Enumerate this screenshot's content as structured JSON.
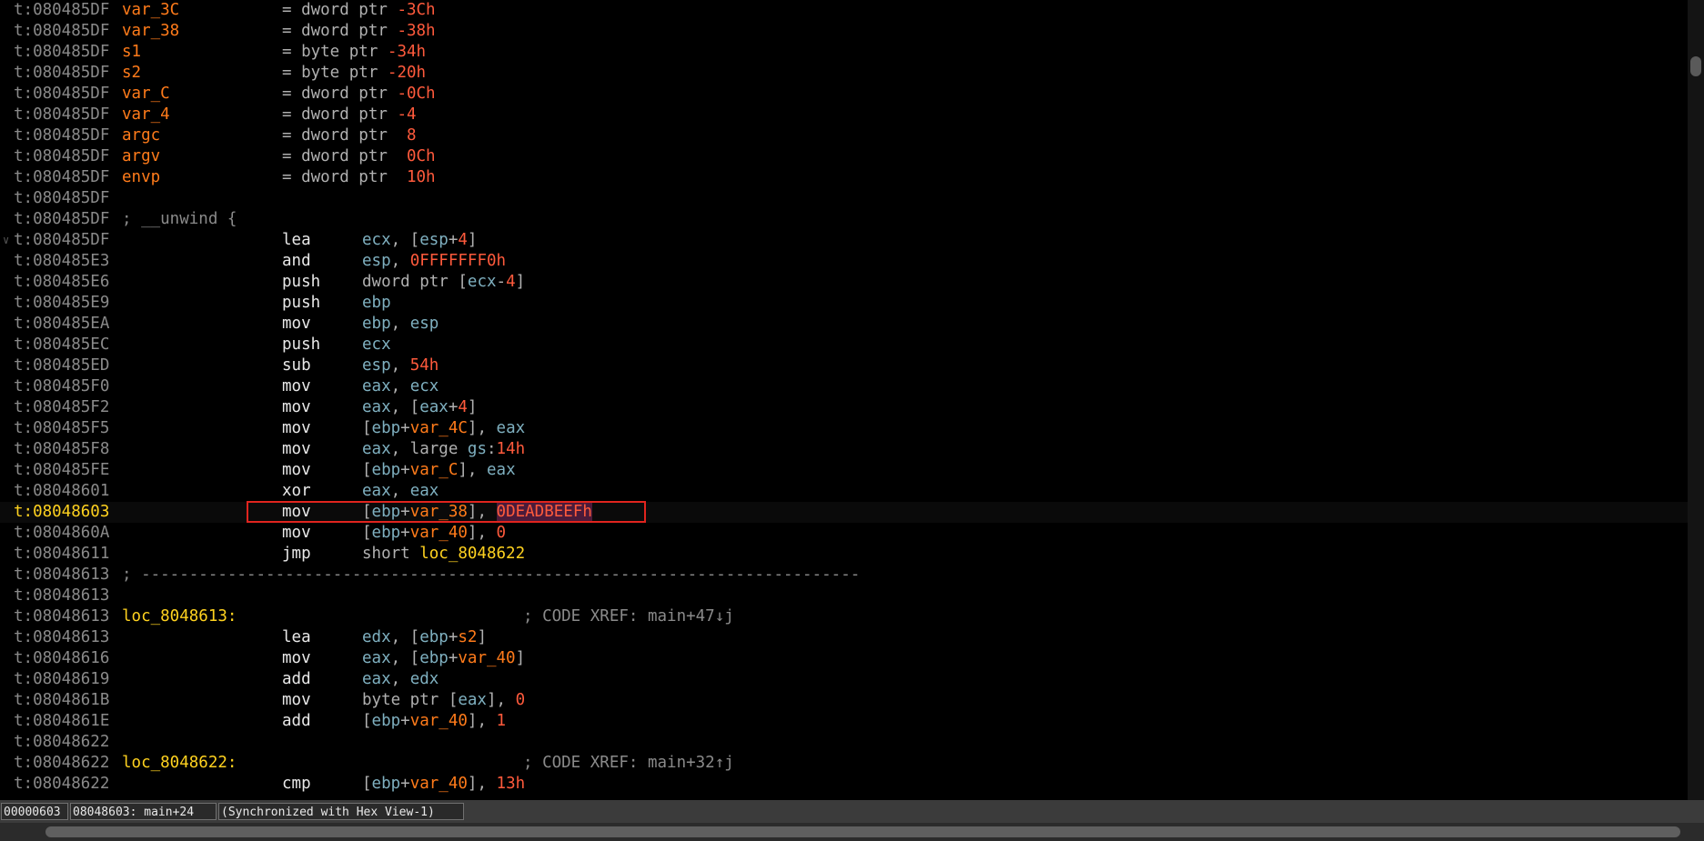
{
  "listing": [
    {
      "kind": "var",
      "addr": "t:080485DF",
      "name": "var_3C",
      "ops": [
        [
          "t-p",
          "dword ptr "
        ],
        [
          "t-num",
          "-3Ch"
        ]
      ]
    },
    {
      "kind": "var",
      "addr": "t:080485DF",
      "name": "var_38",
      "ops": [
        [
          "t-p",
          "dword ptr "
        ],
        [
          "t-num",
          "-38h"
        ]
      ]
    },
    {
      "kind": "var",
      "addr": "t:080485DF",
      "name": "s1",
      "ops": [
        [
          "t-p",
          "byte ptr "
        ],
        [
          "t-num",
          "-34h"
        ]
      ]
    },
    {
      "kind": "var",
      "addr": "t:080485DF",
      "name": "s2",
      "ops": [
        [
          "t-p",
          "byte ptr "
        ],
        [
          "t-num",
          "-20h"
        ]
      ]
    },
    {
      "kind": "var",
      "addr": "t:080485DF",
      "name": "var_C",
      "ops": [
        [
          "t-p",
          "dword ptr "
        ],
        [
          "t-num",
          "-0Ch"
        ]
      ]
    },
    {
      "kind": "var",
      "addr": "t:080485DF",
      "name": "var_4",
      "ops": [
        [
          "t-p",
          "dword ptr "
        ],
        [
          "t-num",
          "-4"
        ]
      ]
    },
    {
      "kind": "var",
      "addr": "t:080485DF",
      "name": "argc",
      "ops": [
        [
          "t-p",
          "dword ptr  "
        ],
        [
          "t-num",
          "8"
        ]
      ]
    },
    {
      "kind": "var",
      "addr": "t:080485DF",
      "name": "argv",
      "ops": [
        [
          "t-p",
          "dword ptr  "
        ],
        [
          "t-num",
          "0Ch"
        ]
      ]
    },
    {
      "kind": "var",
      "addr": "t:080485DF",
      "name": "envp",
      "ops": [
        [
          "t-p",
          "dword ptr  "
        ],
        [
          "t-num",
          "10h"
        ]
      ]
    },
    {
      "kind": "blank",
      "addr": "t:080485DF"
    },
    {
      "kind": "comment",
      "addr": "t:080485DF",
      "text": "; __unwind {"
    },
    {
      "kind": "ins",
      "addr": "t:080485DF",
      "mnem": "lea",
      "fold": true,
      "ops": [
        [
          "t-reg",
          "ecx"
        ],
        [
          "t-p",
          ", ["
        ],
        [
          "t-reg",
          "esp"
        ],
        [
          "t-p",
          "+"
        ],
        [
          "t-num",
          "4"
        ],
        [
          "t-p",
          "]"
        ]
      ]
    },
    {
      "kind": "ins",
      "addr": "t:080485E3",
      "mnem": "and",
      "ops": [
        [
          "t-reg",
          "esp"
        ],
        [
          "t-p",
          ", "
        ],
        [
          "t-num",
          "0FFFFFFF0h"
        ]
      ]
    },
    {
      "kind": "ins",
      "addr": "t:080485E6",
      "mnem": "push",
      "ops": [
        [
          "t-p",
          "dword ptr ["
        ],
        [
          "t-reg",
          "ecx"
        ],
        [
          "t-p",
          "-"
        ],
        [
          "t-num",
          "4"
        ],
        [
          "t-p",
          "]"
        ]
      ]
    },
    {
      "kind": "ins",
      "addr": "t:080485E9",
      "mnem": "push",
      "ops": [
        [
          "t-reg",
          "ebp"
        ]
      ]
    },
    {
      "kind": "ins",
      "addr": "t:080485EA",
      "mnem": "mov",
      "ops": [
        [
          "t-reg",
          "ebp"
        ],
        [
          "t-p",
          ", "
        ],
        [
          "t-reg",
          "esp"
        ]
      ]
    },
    {
      "kind": "ins",
      "addr": "t:080485EC",
      "mnem": "push",
      "ops": [
        [
          "t-reg",
          "ecx"
        ]
      ]
    },
    {
      "kind": "ins",
      "addr": "t:080485ED",
      "mnem": "sub",
      "ops": [
        [
          "t-reg",
          "esp"
        ],
        [
          "t-p",
          ", "
        ],
        [
          "t-num",
          "54h"
        ]
      ]
    },
    {
      "kind": "ins",
      "addr": "t:080485F0",
      "mnem": "mov",
      "ops": [
        [
          "t-reg",
          "eax"
        ],
        [
          "t-p",
          ", "
        ],
        [
          "t-reg",
          "ecx"
        ]
      ]
    },
    {
      "kind": "ins",
      "addr": "t:080485F2",
      "mnem": "mov",
      "ops": [
        [
          "t-reg",
          "eax"
        ],
        [
          "t-p",
          ", ["
        ],
        [
          "t-reg",
          "eax"
        ],
        [
          "t-p",
          "+"
        ],
        [
          "t-num",
          "4"
        ],
        [
          "t-p",
          "]"
        ]
      ]
    },
    {
      "kind": "ins",
      "addr": "t:080485F5",
      "mnem": "mov",
      "ops": [
        [
          "t-p",
          "["
        ],
        [
          "t-reg",
          "ebp"
        ],
        [
          "t-p",
          "+"
        ],
        [
          "t-var",
          "var_4C"
        ],
        [
          "t-p",
          "], "
        ],
        [
          "t-reg",
          "eax"
        ]
      ]
    },
    {
      "kind": "ins",
      "addr": "t:080485F8",
      "mnem": "mov",
      "ops": [
        [
          "t-reg",
          "eax"
        ],
        [
          "t-p",
          ", large "
        ],
        [
          "t-reg",
          "gs"
        ],
        [
          "t-p",
          ":"
        ],
        [
          "t-num",
          "14h"
        ]
      ]
    },
    {
      "kind": "ins",
      "addr": "t:080485FE",
      "mnem": "mov",
      "ops": [
        [
          "t-p",
          "["
        ],
        [
          "t-reg",
          "ebp"
        ],
        [
          "t-p",
          "+"
        ],
        [
          "t-var",
          "var_C"
        ],
        [
          "t-p",
          "], "
        ],
        [
          "t-reg",
          "eax"
        ]
      ]
    },
    {
      "kind": "ins",
      "addr": "t:08048601",
      "mnem": "xor",
      "ops": [
        [
          "t-reg",
          "eax"
        ],
        [
          "t-p",
          ", "
        ],
        [
          "t-reg",
          "eax"
        ]
      ]
    },
    {
      "kind": "ins",
      "addr": "t:08048603",
      "mnem": "mov",
      "current": true,
      "ops": [
        [
          "t-p",
          "["
        ],
        [
          "t-reg",
          "ebp"
        ],
        [
          "t-p",
          "+"
        ],
        [
          "t-var",
          "var_38"
        ],
        [
          "t-p",
          "], "
        ],
        [
          "hl",
          "0DEADBEEFh"
        ]
      ]
    },
    {
      "kind": "ins",
      "addr": "t:0804860A",
      "mnem": "mov",
      "ops": [
        [
          "t-p",
          "["
        ],
        [
          "t-reg",
          "ebp"
        ],
        [
          "t-p",
          "+"
        ],
        [
          "t-var",
          "var_40"
        ],
        [
          "t-p",
          "], "
        ],
        [
          "t-num",
          "0"
        ]
      ]
    },
    {
      "kind": "ins",
      "addr": "t:08048611",
      "mnem": "jmp",
      "ops": [
        [
          "t-p",
          "short "
        ],
        [
          "t-lbl",
          "loc_8048622"
        ]
      ]
    },
    {
      "kind": "sep",
      "addr": "t:08048613",
      "text": "; ---------------------------------------------------------------------------"
    },
    {
      "kind": "blank",
      "addr": "t:08048613"
    },
    {
      "kind": "label",
      "addr": "t:08048613",
      "label": "loc_8048613:",
      "xref": "; CODE XREF: main+47↓j"
    },
    {
      "kind": "ins",
      "addr": "t:08048613",
      "mnem": "lea",
      "ops": [
        [
          "t-reg",
          "edx"
        ],
        [
          "t-p",
          ", ["
        ],
        [
          "t-reg",
          "ebp"
        ],
        [
          "t-p",
          "+"
        ],
        [
          "t-var",
          "s2"
        ],
        [
          "t-p",
          "]"
        ]
      ]
    },
    {
      "kind": "ins",
      "addr": "t:08048616",
      "mnem": "mov",
      "ops": [
        [
          "t-reg",
          "eax"
        ],
        [
          "t-p",
          ", ["
        ],
        [
          "t-reg",
          "ebp"
        ],
        [
          "t-p",
          "+"
        ],
        [
          "t-var",
          "var_40"
        ],
        [
          "t-p",
          "]"
        ]
      ]
    },
    {
      "kind": "ins",
      "addr": "t:08048619",
      "mnem": "add",
      "ops": [
        [
          "t-reg",
          "eax"
        ],
        [
          "t-p",
          ", "
        ],
        [
          "t-reg",
          "edx"
        ]
      ]
    },
    {
      "kind": "ins",
      "addr": "t:0804861B",
      "mnem": "mov",
      "ops": [
        [
          "t-p",
          "byte ptr ["
        ],
        [
          "t-reg",
          "eax"
        ],
        [
          "t-p",
          "], "
        ],
        [
          "t-num",
          "0"
        ]
      ]
    },
    {
      "kind": "ins",
      "addr": "t:0804861E",
      "mnem": "add",
      "ops": [
        [
          "t-p",
          "["
        ],
        [
          "t-reg",
          "ebp"
        ],
        [
          "t-p",
          "+"
        ],
        [
          "t-var",
          "var_40"
        ],
        [
          "t-p",
          "], "
        ],
        [
          "t-num",
          "1"
        ]
      ]
    },
    {
      "kind": "blank",
      "addr": "t:08048622"
    },
    {
      "kind": "label",
      "addr": "t:08048622",
      "label": "loc_8048622:",
      "xref": "; CODE XREF: main+32↑j"
    },
    {
      "kind": "ins",
      "addr": "t:08048622",
      "mnem": "cmp",
      "ops": [
        [
          "t-p",
          "["
        ],
        [
          "t-reg",
          "ebp"
        ],
        [
          "t-p",
          "+"
        ],
        [
          "t-var",
          "var_40"
        ],
        [
          "t-p",
          "], "
        ],
        [
          "t-num",
          "13h"
        ]
      ]
    }
  ],
  "status": {
    "offset": "00000603",
    "location": "08048603: main+24",
    "sync": "(Synchronized with Hex View-1)"
  }
}
